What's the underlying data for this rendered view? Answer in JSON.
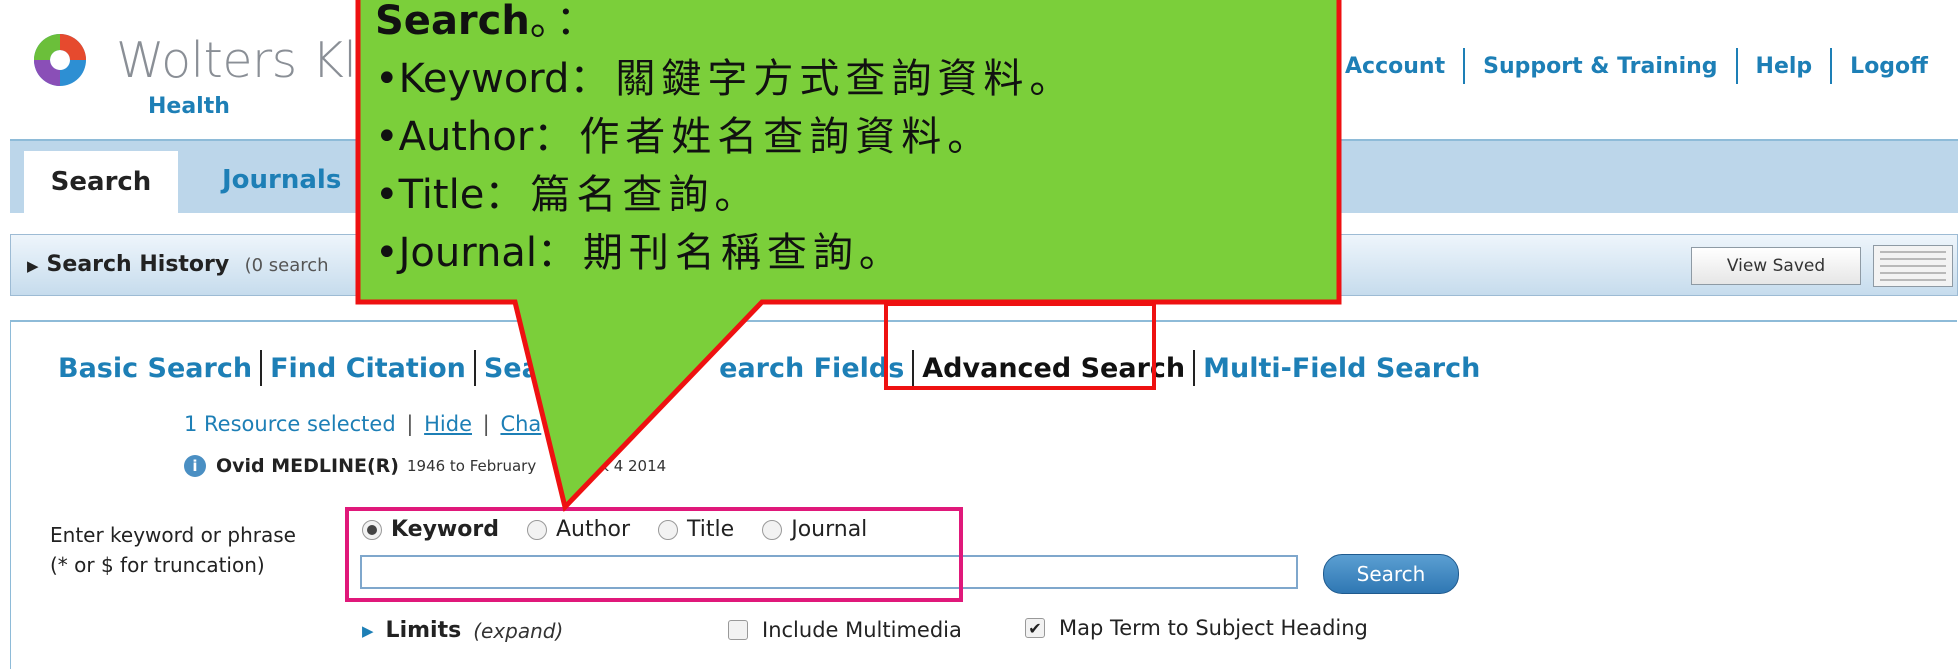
{
  "logo": {
    "brand": "Wolters Kluw",
    "sub": "Health"
  },
  "toplinks": [
    "My Account",
    "Support & Training",
    "Help",
    "Logoff"
  ],
  "tabs": {
    "active": "Search",
    "other": "Journals"
  },
  "history": {
    "label": "Search History",
    "count": "(0 search",
    "view_saved": "View Saved"
  },
  "modes": [
    {
      "label": "Basic Search"
    },
    {
      "label": "Find Citation"
    },
    {
      "label": "Sear"
    },
    {
      "label": "earch Fields"
    },
    {
      "label": "Advanced Search"
    },
    {
      "label": "Multi-Field Search"
    }
  ],
  "resource": {
    "selected": "1 Resource selected",
    "hide": "Hide",
    "change": "Cha"
  },
  "database": {
    "name": "Ovid MEDLINE(R)",
    "range_a": "1946 to February",
    "range_b": "k 4 2014"
  },
  "keyword_label": {
    "line1": "Enter keyword or phrase",
    "line2": "(* or $ for truncation)"
  },
  "search_types": [
    "Keyword",
    "Author",
    "Title",
    "Journal"
  ],
  "search_input_value": "",
  "search_button": "Search",
  "limits": {
    "label": "Limits",
    "expand": "(expand)"
  },
  "options": {
    "include_multimedia": "Include Multimedia",
    "map_term": "Map Term to Subject Heading"
  },
  "callout": {
    "heading": "Search",
    "heading_tail": "。：",
    "lines": [
      {
        "term": "•Keyword",
        "desc": "：關鍵字方式查詢資料。"
      },
      {
        "term": "•Author",
        "desc": "：作者姓名查詢資料。"
      },
      {
        "term": "•Title",
        "desc": "：篇名查詢。"
      },
      {
        "term": "•Journal",
        "desc": "：期刊名稱查詢。"
      }
    ]
  },
  "colors": {
    "link_blue": "#1d7fb6",
    "callout_green": "#7bcf3a",
    "highlight_red": "#ee1111",
    "highlight_pink": "#e0187a"
  }
}
